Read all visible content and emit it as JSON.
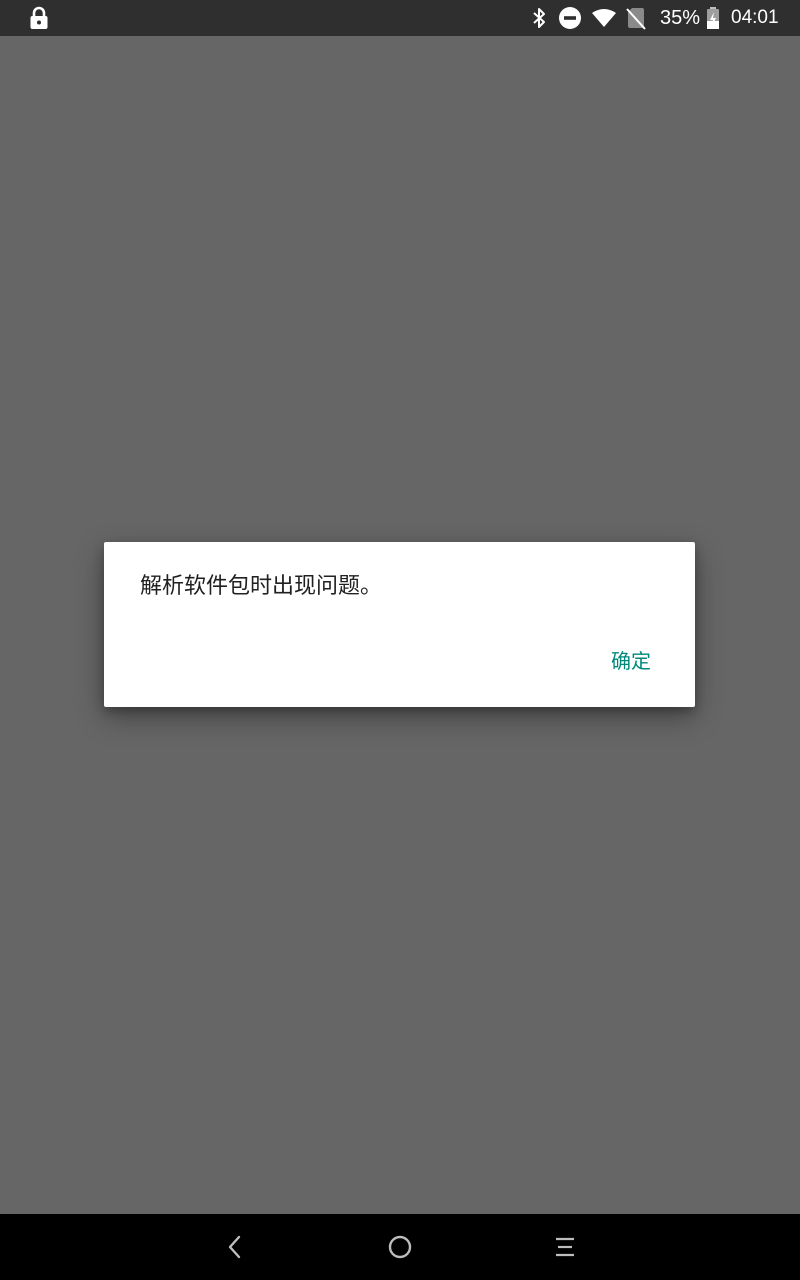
{
  "status_bar": {
    "battery_percent": "35%",
    "time": "04:01",
    "icons": [
      "lock-icon",
      "bluetooth-icon",
      "do-not-disturb-icon",
      "wifi-icon",
      "no-sim-icon",
      "battery-charging-icon"
    ]
  },
  "dialog": {
    "message": "解析软件包时出现问题。",
    "confirm_label": "确定"
  },
  "navigation_bar": {
    "icons": [
      "back-icon",
      "home-icon",
      "menu-icon"
    ]
  },
  "colors": {
    "scrim": "#666666",
    "status_bar": "#2f2f2f",
    "dialog_background": "#ffffff",
    "accent": "#00897b",
    "nav_bar": "#000000"
  }
}
